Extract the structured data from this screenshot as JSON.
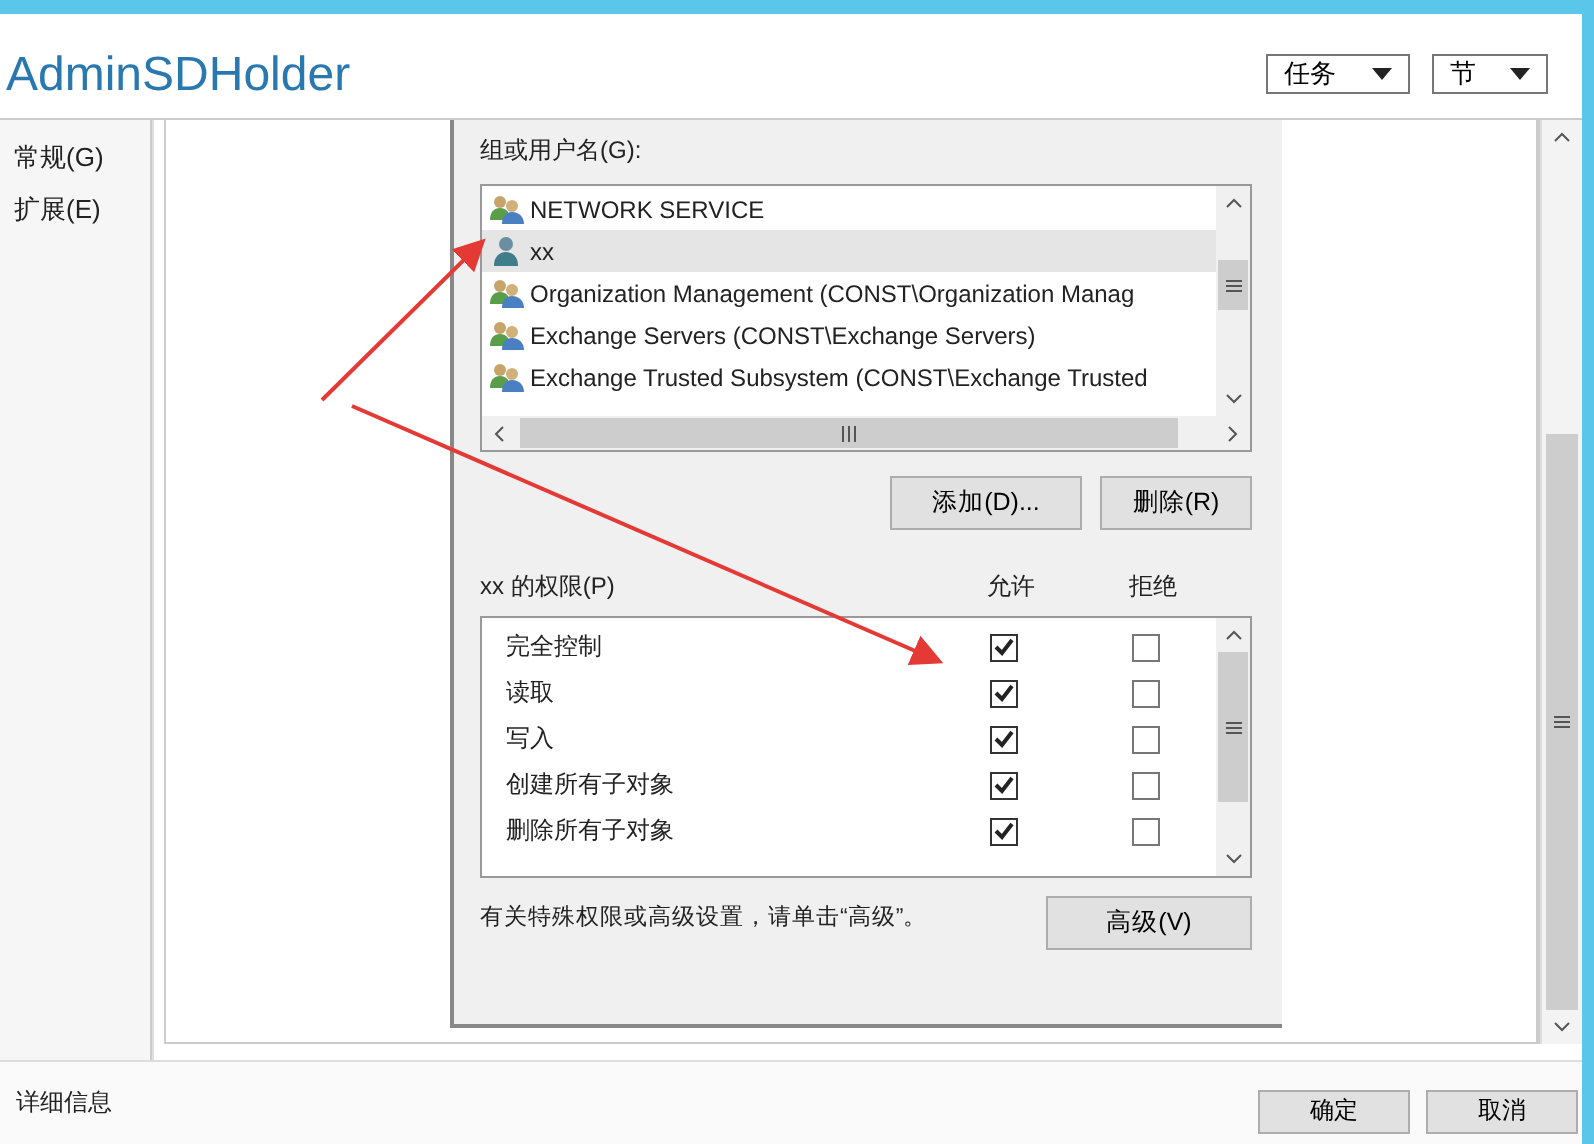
{
  "window": {
    "title": "AdminSDHolder"
  },
  "header_dropdowns": [
    {
      "label": "任务"
    },
    {
      "label": "节"
    }
  ],
  "sidebar": {
    "items": [
      {
        "label": "常规(G)"
      },
      {
        "label": "扩展(E)"
      }
    ]
  },
  "dialog": {
    "group_label": "组或用户名(G):",
    "principals": [
      {
        "name": "NETWORK SERVICE",
        "kind": "group",
        "selected": false
      },
      {
        "name": "xx",
        "kind": "user",
        "selected": true
      },
      {
        "name": "Organization Management (CONST\\Organization Manag",
        "kind": "group",
        "selected": false
      },
      {
        "name": "Exchange Servers (CONST\\Exchange Servers)",
        "kind": "group",
        "selected": false
      },
      {
        "name": "Exchange Trusted Subsystem (CONST\\Exchange Trusted",
        "kind": "group",
        "selected": false
      }
    ],
    "add_button": "添加(D)...",
    "remove_button": "删除(R)",
    "permissions_label": "xx 的权限(P)",
    "allow_header": "允许",
    "deny_header": "拒绝",
    "permissions": [
      {
        "name": "完全控制",
        "allow": true,
        "deny": false
      },
      {
        "name": "读取",
        "allow": true,
        "deny": false
      },
      {
        "name": "写入",
        "allow": true,
        "deny": false
      },
      {
        "name": "创建所有子对象",
        "allow": true,
        "deny": false
      },
      {
        "name": "删除所有子对象",
        "allow": true,
        "deny": false
      }
    ],
    "advanced_note": "有关特殊权限或高级设置，请单击“高级”。",
    "advanced_button": "高级(V)"
  },
  "status_bar": {
    "details": "详细信息"
  },
  "buttons": [
    {
      "label": "确定"
    },
    {
      "label": "取消"
    }
  ]
}
